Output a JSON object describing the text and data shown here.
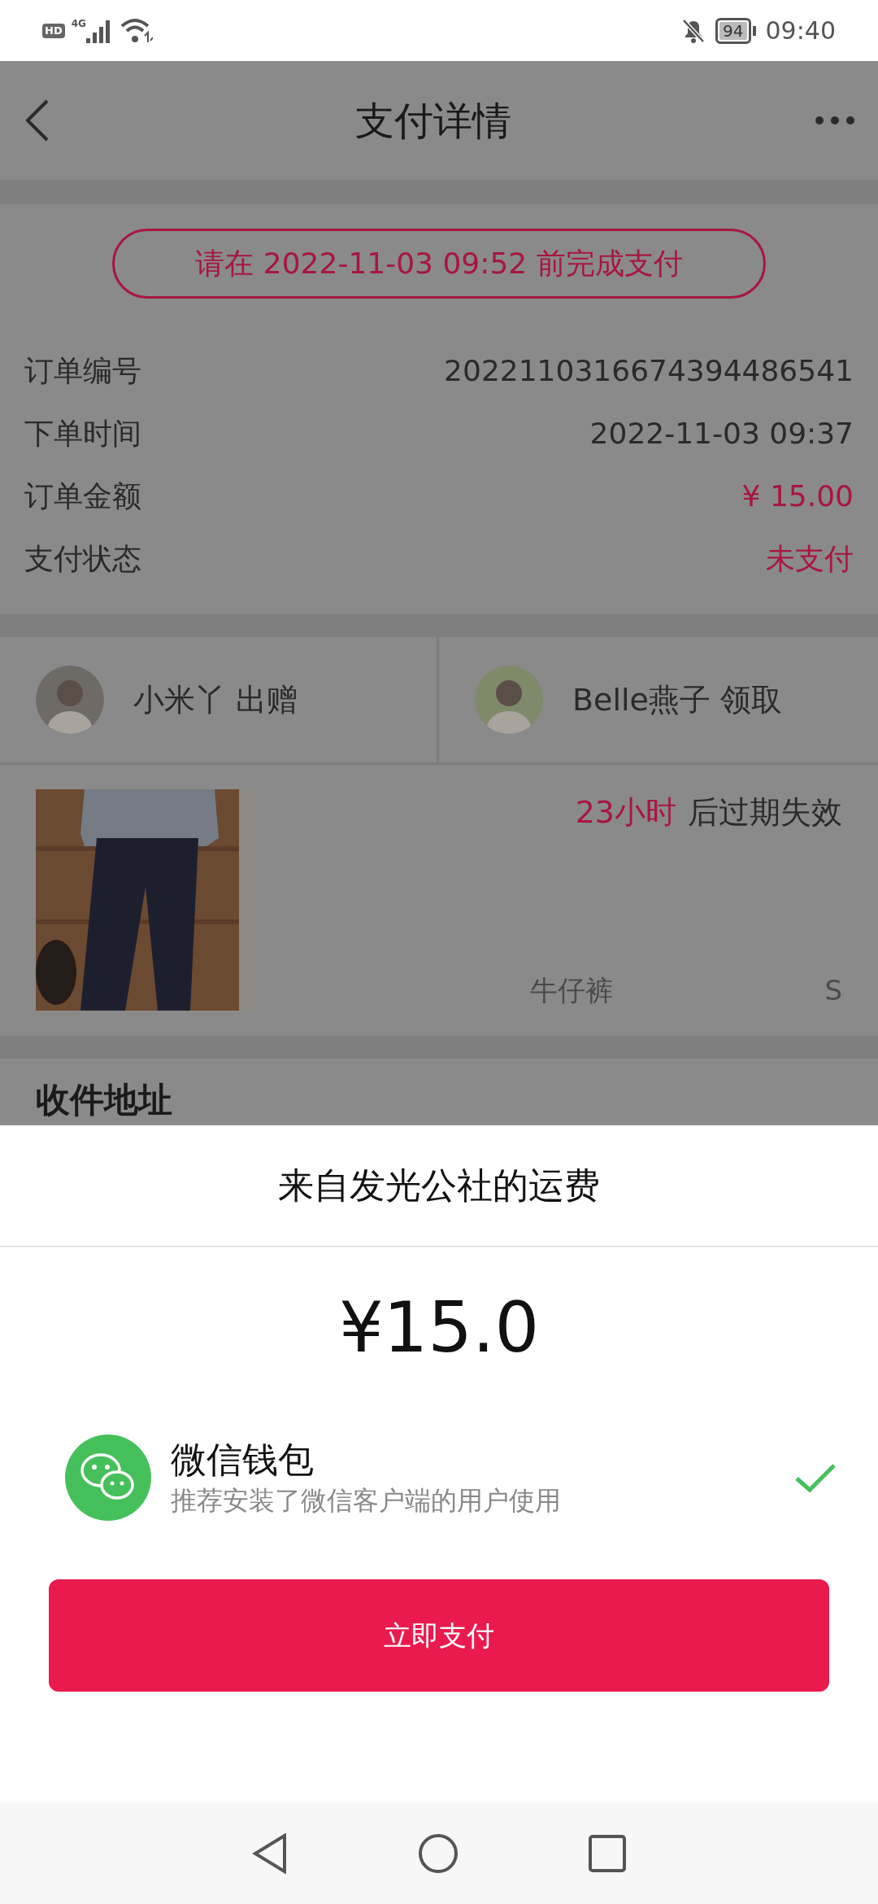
{
  "status_bar": {
    "hd": "HD",
    "network": "4G",
    "battery": "94",
    "time": "09:40"
  },
  "header": {
    "title": "支付详情"
  },
  "deadline": "请在 2022-11-03 09:52 前完成支付",
  "details": [
    {
      "label": "订单编号",
      "value": "2022110316674394486541",
      "emphasis": false
    },
    {
      "label": "下单时间",
      "value": "2022-11-03 09:37",
      "emphasis": false
    },
    {
      "label": "订单金额",
      "value": "¥ 15.00",
      "emphasis": true
    },
    {
      "label": "支付状态",
      "value": "未支付",
      "emphasis": true
    }
  ],
  "users": [
    {
      "name": "小米丫",
      "action": "出赠"
    },
    {
      "name": "Belle燕子",
      "action": "领取"
    }
  ],
  "product": {
    "expiry_time": "23小时",
    "expiry_text": "后过期失效",
    "name": "牛仔裤",
    "size": "S"
  },
  "address": {
    "heading": "收件地址"
  },
  "sheet": {
    "title": "来自发光公社的运费",
    "amount": "¥15.0",
    "methods": [
      {
        "name": "微信钱包",
        "description": "推荐安装了微信客户端的用户使用",
        "selected": true
      }
    ],
    "pay_button": "立即支付"
  }
}
